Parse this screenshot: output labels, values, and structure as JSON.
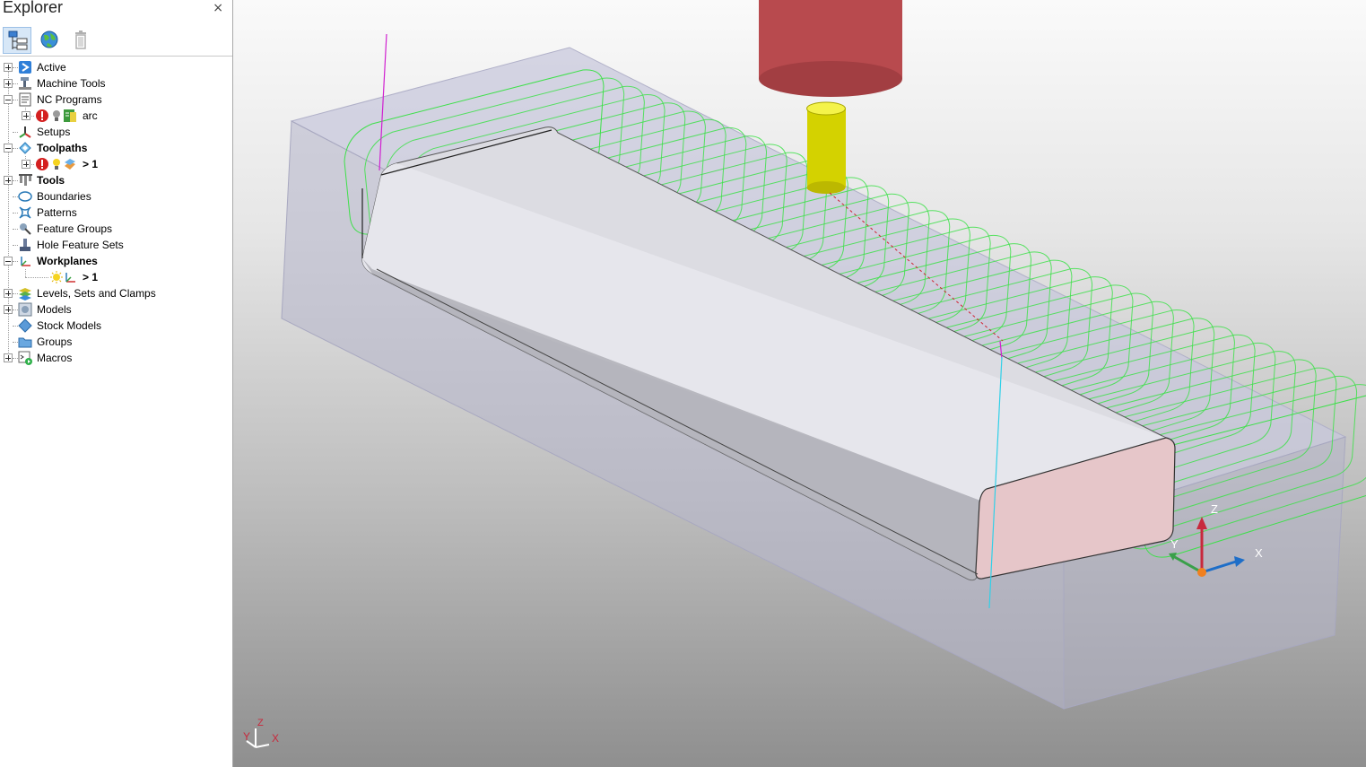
{
  "explorer": {
    "title": "Explorer",
    "close_glyph": "×",
    "toolbar": {
      "tree_icon": "tree-view-icon",
      "web_icon": "globe-icon",
      "delete_icon": "trash-icon"
    },
    "items": [
      {
        "label": "Active"
      },
      {
        "label": "Machine Tools"
      },
      {
        "label": "NC Programs"
      },
      {
        "label": "arc"
      },
      {
        "label": "Setups"
      },
      {
        "label": "Toolpaths"
      },
      {
        "label": "> 1"
      },
      {
        "label": "Tools"
      },
      {
        "label": "Boundaries"
      },
      {
        "label": "Patterns"
      },
      {
        "label": "Feature Groups"
      },
      {
        "label": "Hole Feature Sets"
      },
      {
        "label": "Workplanes"
      },
      {
        "label": "> 1"
      },
      {
        "label": "Levels, Sets and Clamps"
      },
      {
        "label": "Models"
      },
      {
        "label": "Stock Models"
      },
      {
        "label": "Groups"
      },
      {
        "label": "Macros"
      }
    ]
  },
  "viewport": {
    "workplane_axes": {
      "x": "X",
      "y": "Y",
      "z": "Z"
    },
    "view_axes": {
      "x": "X",
      "y": "Y",
      "z": "Z"
    },
    "colors": {
      "toolpath": "#3ee04a",
      "holder": "#b84a4e",
      "tool": "#e2e100",
      "stock": "#c8c8dc",
      "x_axis": "#1e6ec8",
      "y_axis": "#3aa04a",
      "z_axis": "#c8283c"
    }
  }
}
